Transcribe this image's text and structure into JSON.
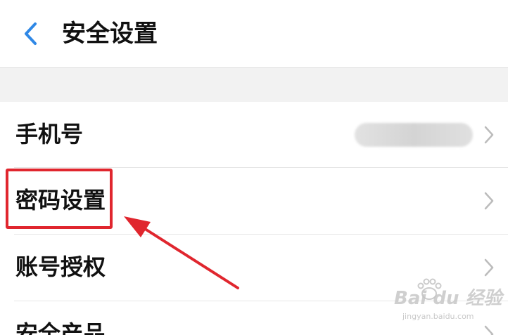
{
  "header": {
    "title": "安全设置"
  },
  "items": [
    {
      "label": "手机号"
    },
    {
      "label": "密码设置"
    },
    {
      "label": "账号授权"
    },
    {
      "label": "安全产品"
    }
  ],
  "watermark": {
    "logo": "Bai du 经验",
    "sub": "jingyan.baidu.com"
  },
  "colors": {
    "accent": "#2f88e6",
    "annotation": "#e0262e"
  }
}
